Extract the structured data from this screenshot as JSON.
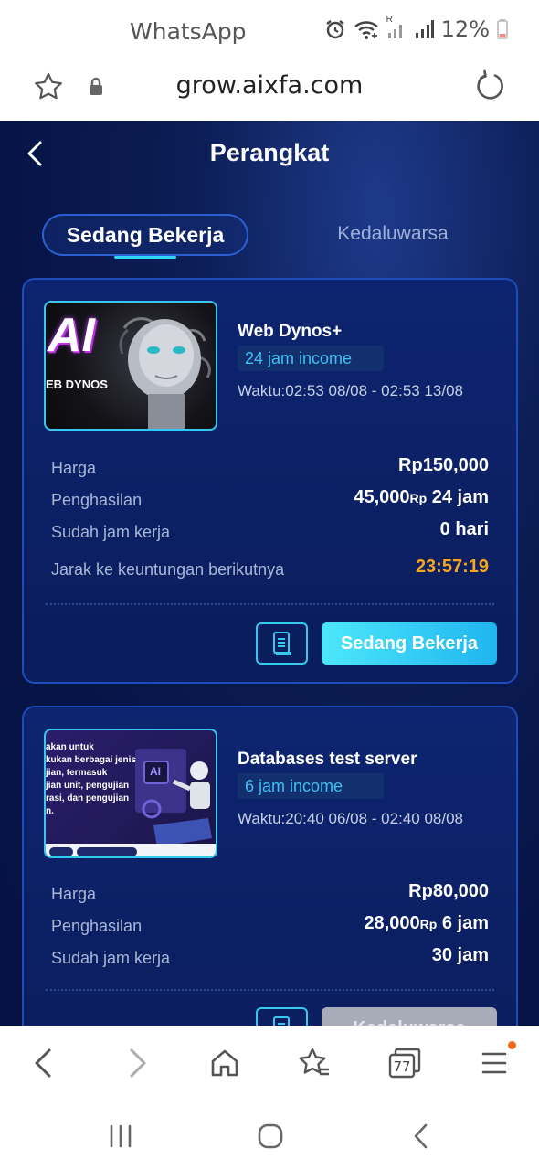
{
  "status_bar": {
    "app_name": "WhatsApp",
    "battery": "12%",
    "signal_roaming": "R"
  },
  "url_bar": {
    "url": "grow.aixfa.com"
  },
  "header": {
    "title": "Perangkat"
  },
  "tabs": [
    {
      "label": "Sedang Bekerja",
      "active": true
    },
    {
      "label": "Kedaluwarsa",
      "active": false
    }
  ],
  "cards": [
    {
      "thumb_text_big": "AI",
      "thumb_text_small": "EB DYNOS",
      "name": "Web Dynos+",
      "income_badge": "24 jam income",
      "time": "Waktu:02:53 08/08 - 02:53 13/08",
      "rows": [
        {
          "label": "Harga",
          "value": "Rp150,000"
        },
        {
          "label": "Penghasilan",
          "amount": "45,000",
          "currency": "Rp",
          "period": "24 jam"
        },
        {
          "label": "Sudah jam kerja",
          "value": "0 hari"
        },
        {
          "label": "Jarak ke keuntungan berikutnya",
          "value": "23:57:19"
        }
      ],
      "button_label": "Sedang Bekerja"
    },
    {
      "thumb_lines": [
        "akan untuk",
        "kukan berbagai jenis",
        "jian, termasuk",
        "jian unit, pengujian",
        "rasi, dan pengujian",
        "n."
      ],
      "thumb_badge": "AI",
      "name": "Databases test server",
      "income_badge": "6 jam income",
      "time": "Waktu:20:40 06/08 - 02:40 08/08",
      "rows": [
        {
          "label": "Harga",
          "value": "Rp80,000"
        },
        {
          "label": "Penghasilan",
          "amount": "28,000",
          "currency": "Rp",
          "period": "6 jam"
        },
        {
          "label": "Sudah jam kerja",
          "value": "30 jam"
        }
      ],
      "button_label": "Kedaluwarsa"
    }
  ],
  "browser_nav": {
    "tabs_count": "77"
  },
  "colors": {
    "accent_cyan": "#37c8f0",
    "countdown": "#f5a623",
    "background": "#061447"
  }
}
